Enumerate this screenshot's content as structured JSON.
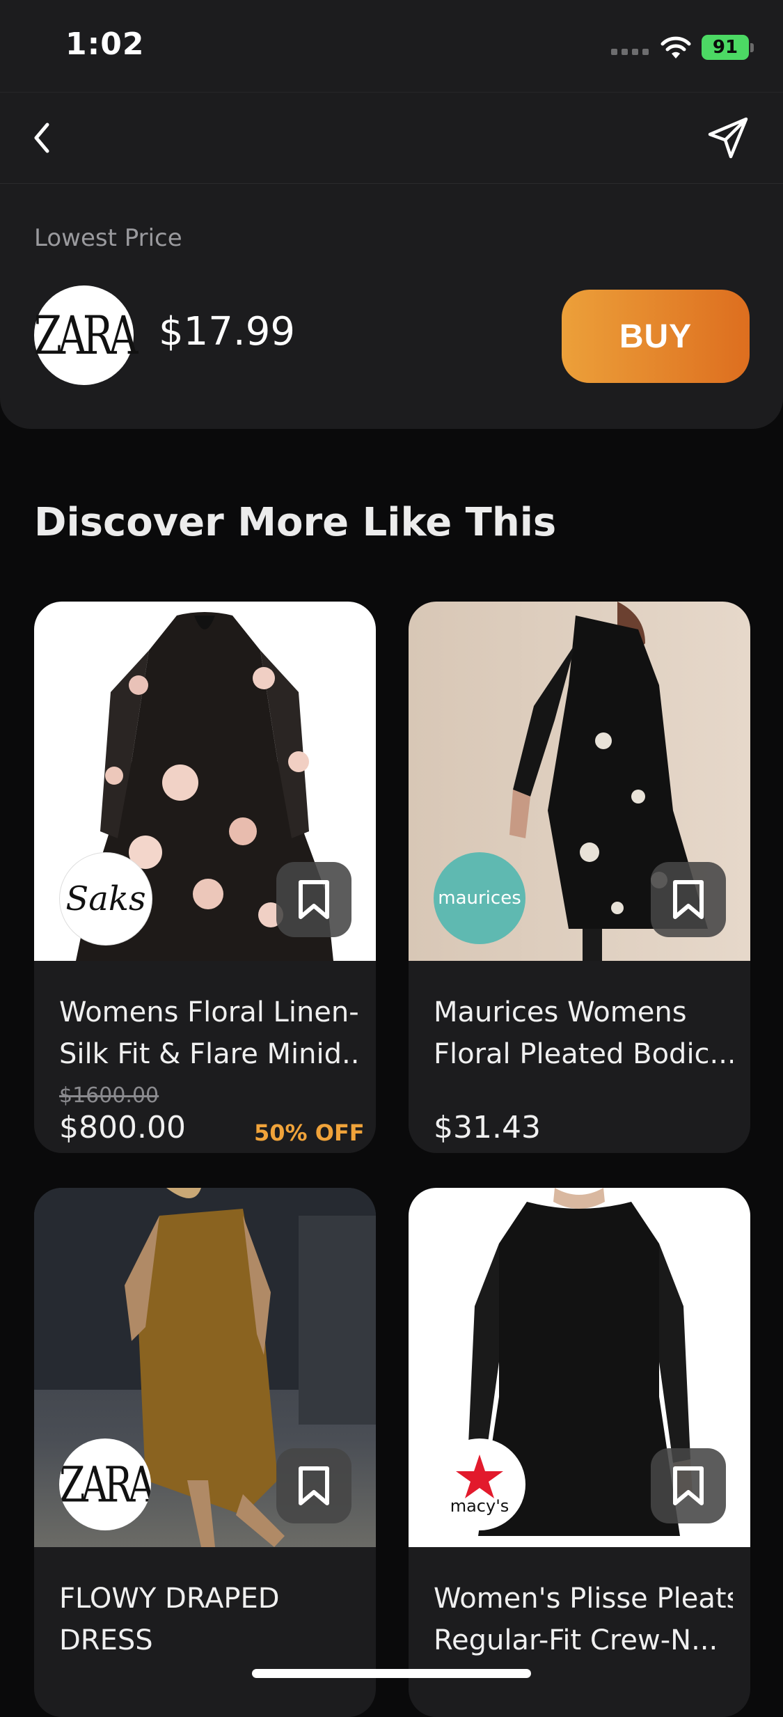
{
  "status_bar": {
    "time": "1:02",
    "battery": "91"
  },
  "nav": {
    "back_icon": "chevron-left-icon",
    "share_icon": "paper-plane-icon"
  },
  "lowest_price": {
    "label": "Lowest Price",
    "store_logo_text": "ZARA",
    "price": "$17.99",
    "buy_label": "BUY",
    "colors": {
      "buy_gradient_start": "#eca03a",
      "buy_gradient_end": "#dd6e1f"
    }
  },
  "discover": {
    "title": "Discover More Like This",
    "products": [
      {
        "title_line1": "Womens Floral Linen-",
        "title_line2": "Silk Fit & Flare Minid...",
        "retailer": "Saks",
        "original_price": "$1600.00",
        "price": "$800.00",
        "discount": "50% OFF"
      },
      {
        "title_line1": "Maurices Womens",
        "title_line2": "Floral Pleated Bodic...",
        "retailer": "maurices",
        "price": "$31.43"
      },
      {
        "title_line1": "FLOWY DRAPED",
        "title_line2": "DRESS",
        "retailer": "ZARA"
      },
      {
        "title_line1": "Women's Plisse Pleats",
        "title_line2": "Regular-Fit Crew-N...",
        "retailer": "macy's"
      }
    ]
  },
  "colors": {
    "background": "#0a0a0b",
    "surface": "#1c1c1e",
    "discount": "#f0a33a",
    "battery": "#4cd964"
  }
}
